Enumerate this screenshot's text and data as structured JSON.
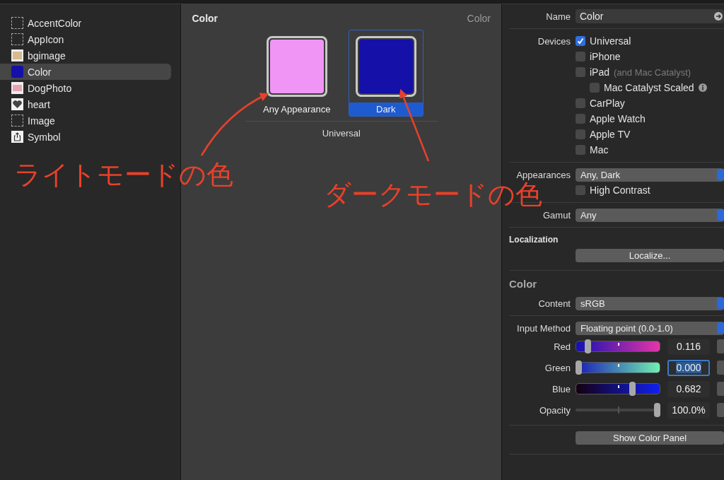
{
  "sidebar": {
    "items": [
      {
        "label": "AccentColor",
        "kind": "empty",
        "selected": false
      },
      {
        "label": "AppIcon",
        "kind": "empty",
        "selected": false
      },
      {
        "label": "bgimage",
        "kind": "image",
        "selected": false
      },
      {
        "label": "Color",
        "kind": "color",
        "selected": true
      },
      {
        "label": "DogPhoto",
        "kind": "photo",
        "selected": false
      },
      {
        "label": "heart",
        "kind": "heart",
        "selected": false
      },
      {
        "label": "Image",
        "kind": "empty",
        "selected": false
      },
      {
        "label": "Symbol",
        "kind": "symbol",
        "selected": false
      }
    ]
  },
  "editor": {
    "title": "Color",
    "type_label": "Color",
    "wells": [
      {
        "label": "Any Appearance",
        "color": "#f095f5",
        "selected": false
      },
      {
        "label": "Dark",
        "color": "#1410a8",
        "selected": true
      }
    ],
    "group_label": "Universal"
  },
  "inspector": {
    "name": {
      "label": "Name",
      "value": "Color"
    },
    "devices": {
      "label": "Devices",
      "options": [
        {
          "label": "Universal",
          "checked": true
        },
        {
          "label": "iPhone",
          "checked": false
        },
        {
          "label": "iPad",
          "note": "(and Mac Catalyst)",
          "checked": false,
          "children": [
            {
              "label": "Mac Catalyst Scaled",
              "checked": false
            }
          ]
        },
        {
          "label": "CarPlay",
          "checked": false
        },
        {
          "label": "Apple Watch",
          "checked": false
        },
        {
          "label": "Apple TV",
          "checked": false
        },
        {
          "label": "Mac",
          "checked": false
        }
      ]
    },
    "appearances": {
      "label": "Appearances",
      "value": "Any, Dark"
    },
    "high_contrast": {
      "label": "High Contrast",
      "checked": false
    },
    "gamut": {
      "label": "Gamut",
      "value": "Any"
    },
    "localization": {
      "title": "Localization",
      "button": "Localize..."
    },
    "color": {
      "title": "Color",
      "content": {
        "label": "Content",
        "value": "sRGB"
      },
      "input_method": {
        "label": "Input Method",
        "value": "Floating point (0.0-1.0)"
      },
      "sliders": [
        {
          "kind": "red",
          "label": "Red",
          "level": 0.116,
          "value": "0.116",
          "focused": false
        },
        {
          "kind": "green",
          "label": "Green",
          "level": 0,
          "value": "0.000",
          "focused": true
        },
        {
          "kind": "blue",
          "label": "Blue",
          "level": 0.682,
          "value": "0.682",
          "focused": false
        },
        {
          "kind": "opacity",
          "label": "Opacity",
          "level": 1,
          "value": "100.0%",
          "focused": false
        }
      ],
      "button": "Show Color Panel"
    }
  },
  "annotations": [
    {
      "kind": "light",
      "text": "ライトモードの色"
    },
    {
      "kind": "dark",
      "text": "ダークモードの色"
    }
  ]
}
